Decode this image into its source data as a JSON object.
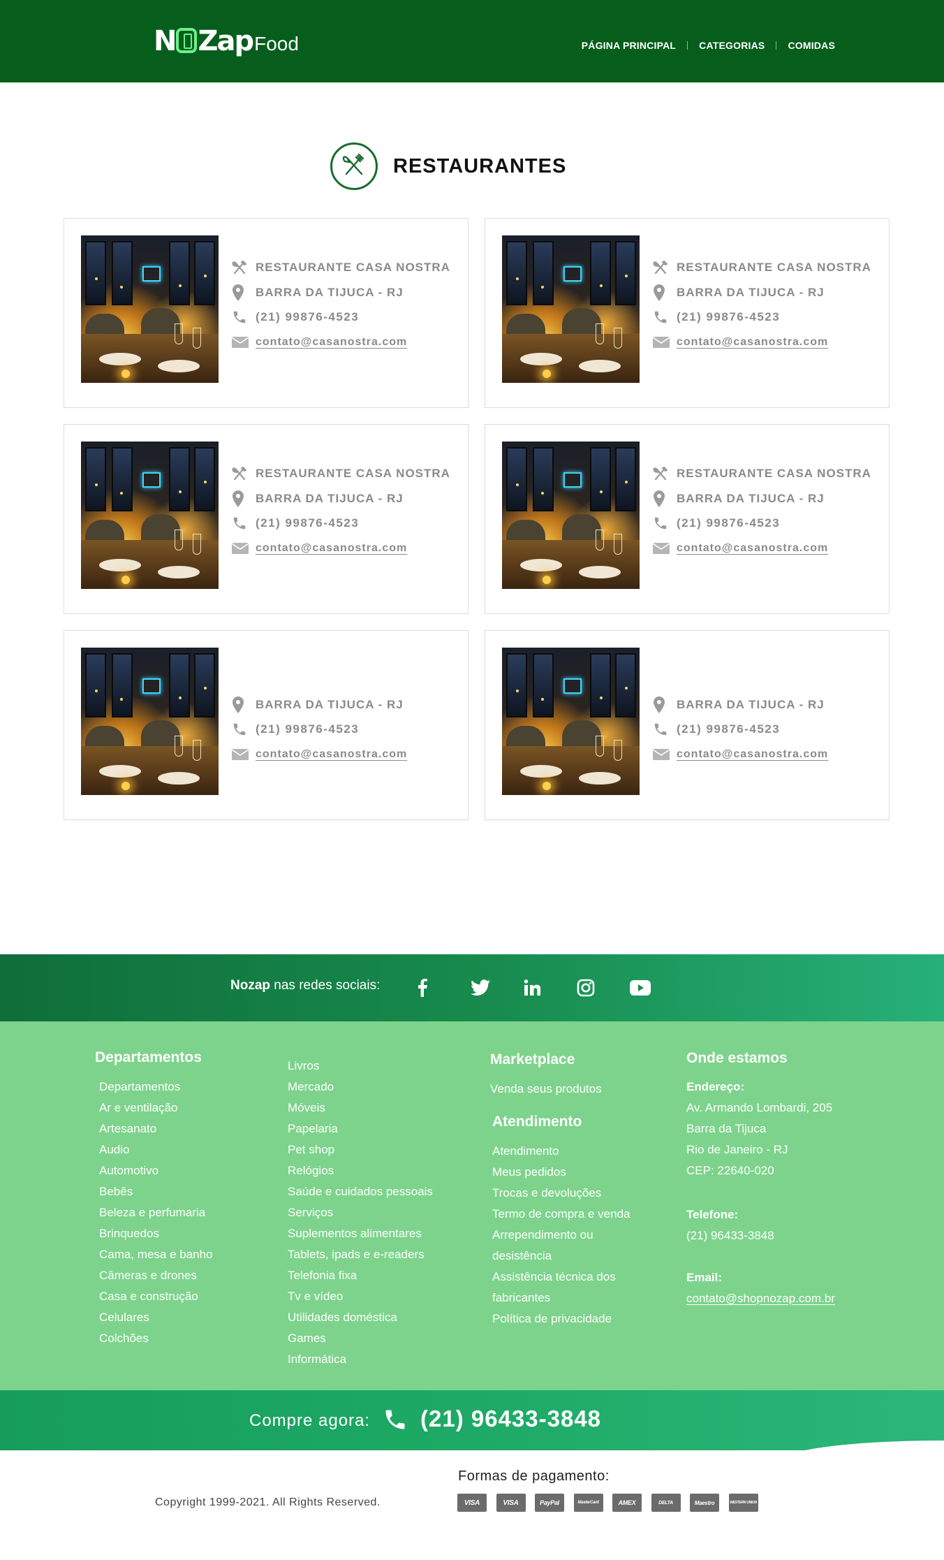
{
  "header": {
    "logo_brand": "NOZap",
    "logo_brand_pre": "N",
    "logo_brand_post": "Zap",
    "logo_suffix": "Food",
    "nav": [
      "PÁGINA PRINCIPAL",
      "CATEGORIAS",
      "COMIDAS"
    ]
  },
  "page_title": "RESTAURANTES",
  "restaurants": [
    {
      "name": "RESTAURANTE CASA NOSTRA",
      "location": "BARRA DA TIJUCA - RJ",
      "phone": "(21) 99876-4523",
      "email": "contato@casanostra.com"
    },
    {
      "name": "RESTAURANTE CASA NOSTRA",
      "location": "BARRA DA TIJUCA - RJ",
      "phone": "(21) 99876-4523",
      "email": "contato@casanostra.com"
    },
    {
      "name": "RESTAURANTE CASA NOSTRA",
      "location": "BARRA DA TIJUCA - RJ",
      "phone": "(21) 99876-4523",
      "email": "contato@casanostra.com"
    },
    {
      "name": "RESTAURANTE CASA NOSTRA",
      "location": "BARRA DA TIJUCA - RJ",
      "phone": "(21) 99876-4523",
      "email": "contato@casanostra.com"
    },
    {
      "name": "",
      "location": "BARRA DA TIJUCA - RJ",
      "phone": "(21) 99876-4523",
      "email": "contato@casanostra.com"
    },
    {
      "name": "",
      "location": "BARRA DA TIJUCA - RJ",
      "phone": "(21) 99876-4523",
      "email": "contato@casanostra.com"
    }
  ],
  "social": {
    "brand": "Nozap",
    "label": "nas redes sociais:",
    "icons": [
      "facebook-icon",
      "twitter-icon",
      "linkedin-icon",
      "instagram-icon",
      "youtube-icon"
    ]
  },
  "footer": {
    "departamentos_title": "Departamentos",
    "departamentos_col1": [
      "Departamentos",
      "Ar e ventilação",
      "Artesanato",
      "Audio",
      "Automotivo",
      "Bebês",
      "Beleza e perfumaria",
      "Brinquedos",
      "Cama, mesa e banho",
      "Câmeras e drones",
      "Casa e construção",
      "Celulares",
      "Colchões"
    ],
    "departamentos_col2": [
      "Livros",
      "Mercado",
      "Móveis",
      "Papelaria",
      "Pet shop",
      "Relógios",
      "Saúde e cuidados pessoais",
      "Serviços",
      "Suplementos alimentares",
      "Tablets, ipads e e-readers",
      "Telefonia fixa",
      "Tv e vídeo",
      "Utilidades doméstica",
      "Games",
      "Informática"
    ],
    "marketplace_title": "Marketplace",
    "marketplace_items": [
      "Venda seus produtos"
    ],
    "atendimento_title": "Atendimento",
    "atendimento_items": [
      "Atendimento",
      "Meus pedidos",
      "Trocas e devoluções",
      "Termo de compra e venda",
      "Arrependimento ou",
      "desistência",
      "Assistência técnica dos",
      "fabricantes",
      "Política de privacidade"
    ],
    "onde_title": "Onde estamos",
    "endereco_label": "Endereço:",
    "endereco_lines": [
      "Av. Armando Lombardi, 205",
      "Barra da Tijuca",
      "Rio de Janeiro - RJ",
      "CEP: 22640-020"
    ],
    "telefone_label": "Telefone:",
    "telefone": "(21) 96433-3848",
    "email_label": "Email:",
    "email": "contato@shopnozap.com.br"
  },
  "buy": {
    "label": "Compre agora:",
    "phone": "(21) 96433-3848"
  },
  "bottom": {
    "copyright": "Copyright 1999-2021. All Rights Reserved.",
    "payment_label": "Formas de pagamento:",
    "payment_methods": [
      "VISA",
      "VISA",
      "PayPal",
      "MasterCard",
      "AMEX",
      "DELTA",
      "Maestro",
      "WESTERN UNION"
    ]
  },
  "colors": {
    "header_bg": "#075e1c",
    "footer_bg": "#7dd38b",
    "accent_green": "#1a6b2e",
    "card_text": "#8a8a8a"
  }
}
